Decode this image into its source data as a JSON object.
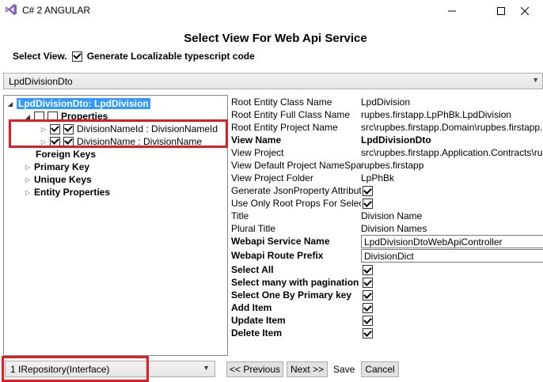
{
  "window": {
    "title": "C# 2 ANGULAR"
  },
  "heading": "Select View For Web Api Service",
  "view_row": {
    "label": "Select View.",
    "checkbox_label": "Generate Localizable typescript code",
    "checked": true
  },
  "view_select": {
    "value": "LpdDivisionDto"
  },
  "tree": {
    "root": "LpdDivisionDto: LpdDivision",
    "properties": "Properties",
    "prop_items": [
      "DivisionNameId : DivisionNameId",
      "DivisionName : DivisionName"
    ],
    "foreign_keys": "Foreign Keys",
    "primary_key": "Primary Key",
    "unique_keys": "Unique Keys",
    "entity_properties": "Entity Properties"
  },
  "props": {
    "root_entity_class_name": {
      "label": "Root Entity Class Name",
      "value": "LpdDivision"
    },
    "root_entity_full_class_name": {
      "label": "Root Entity Full Class Name",
      "value": "rupbes.firstapp.LpPhBk.LpdDivision"
    },
    "root_entity_project_name": {
      "label": "Root Entity Project Name",
      "value": "src\\rupbes.firstapp.Domain\\rupbes.firstapp."
    },
    "view_name": {
      "label": "View Name",
      "value": "LpdDivisionDto"
    },
    "view_project": {
      "label": "View Project",
      "value": "src\\rupbes.firstapp.Application.Contracts\\ru"
    },
    "view_default_namespace": {
      "label": "View Default Project NameSpace",
      "value": "rupbes.firstapp"
    },
    "view_project_folder": {
      "label": "View Project Folder",
      "value": "LpPhBk"
    },
    "generate_json_property": {
      "label": "Generate JsonProperty Attribute",
      "checked": true
    },
    "use_only_root_props": {
      "label": "Use Only Root Props For Select",
      "checked": true
    },
    "title": {
      "label": "Title",
      "value": "Division Name"
    },
    "plural_title": {
      "label": "Plural Title",
      "value": "Division Names"
    },
    "webapi_service_name": {
      "label": "Webapi Service Name",
      "value": "LpdDivisionDtoWebApiController"
    },
    "webapi_route_prefix": {
      "label": "Webapi Route Prefix",
      "value": "DivisionDict"
    },
    "select_all": {
      "label": "Select All",
      "checked": true
    },
    "select_many": {
      "label": "Select many with pagination",
      "checked": true
    },
    "select_one": {
      "label": "Select One By Primary key",
      "checked": true
    },
    "add_item": {
      "label": "Add Item",
      "checked": true
    },
    "update_item": {
      "label": "Update Item",
      "checked": true
    },
    "delete_item": {
      "label": "Delete Item",
      "checked": true
    }
  },
  "bottom": {
    "repo_select": "1 IRepository(Interface)",
    "previous": "<< Previous",
    "next": "Next >>",
    "save": "Save",
    "cancel": "Cancel"
  },
  "colors": {
    "selection": "#3399ff",
    "highlight_box": "#e31b23"
  }
}
